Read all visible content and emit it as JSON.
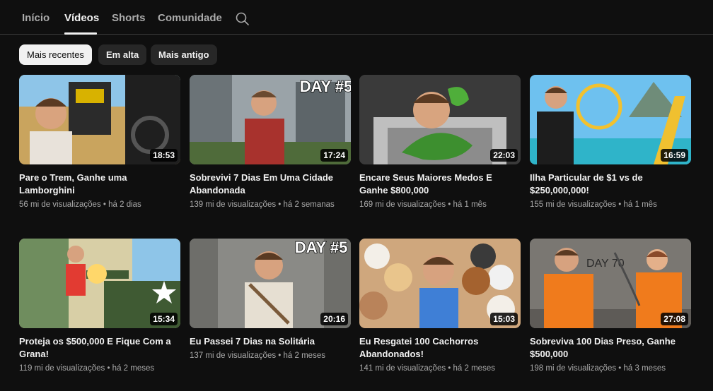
{
  "tabs": [
    "Início",
    "Vídeos",
    "Shorts",
    "Comunidade"
  ],
  "active_tab": "Vídeos",
  "filters": [
    "Mais recentes",
    "Em alta",
    "Mais antigo"
  ],
  "active_filter": "Mais recentes",
  "colors": {
    "background": "#0f0f0f",
    "chip": "#272727",
    "chip_active": "#f1f1f1",
    "text_secondary": "#aaaaaa"
  },
  "videos": [
    {
      "title": "Pare o Trem, Ganhe uma Lamborghini",
      "views": "56 mi de visualizações",
      "age": "há 2 dias",
      "duration": "18:53"
    },
    {
      "title": "Sobrevivi 7 Dias Em Uma Cidade Abandonada",
      "views": "139 mi de visualizações",
      "age": "há 2 semanas",
      "duration": "17:24",
      "badge": "DAY #5"
    },
    {
      "title": "Encare Seus Maiores Medos E Ganhe $800,000",
      "views": "169 mi de visualizações",
      "age": "há 1 mês",
      "duration": "22:03"
    },
    {
      "title": "Ilha Particular de $1 vs de $250,000,000!",
      "views": "155 mi de visualizações",
      "age": "há 1 mês",
      "duration": "16:59"
    },
    {
      "title": "Proteja os $500,000 E Fique Com a Grana!",
      "views": "119 mi de visualizações",
      "age": "há 2 meses",
      "duration": "15:34"
    },
    {
      "title": "Eu Passei 7 Dias na Solitária",
      "views": "137 mi de visualizações",
      "age": "há 2 meses",
      "duration": "20:16",
      "badge": "DAY #5"
    },
    {
      "title": "Eu Resgatei 100 Cachorros Abandonados!",
      "views": "141 mi de visualizações",
      "age": "há 2 meses",
      "duration": "15:03"
    },
    {
      "title": "Sobreviva 100 Dias Preso, Ganhe $500,000",
      "views": "198 mi de visualizações",
      "age": "há 3 meses",
      "duration": "27:08",
      "badge": "DAY 70"
    }
  ]
}
